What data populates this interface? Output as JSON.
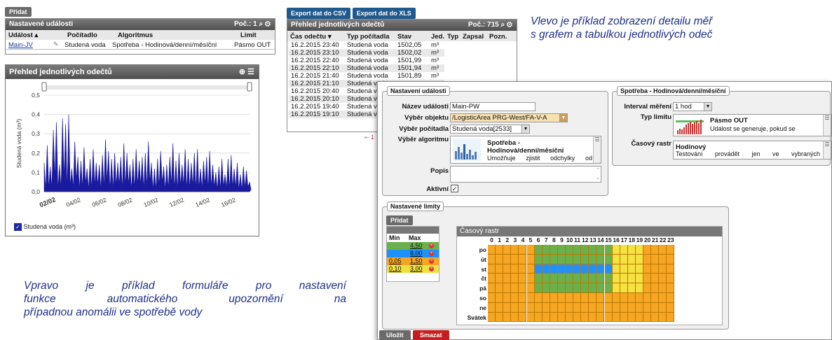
{
  "left_panel": {
    "add_button": "Přidat",
    "title": "Nastavené události",
    "count_label": "Poč.: 1",
    "columns": [
      "Událost",
      "Počítadlo",
      "Algoritmus",
      "Limit"
    ],
    "row": {
      "event": "Main-JV",
      "counter": "Studená voda",
      "algorithm": "Spotřeba - Hodinová/denní/měsíční",
      "limit": "Pásmo OUT"
    }
  },
  "chart_panel": {
    "title": "Přehled jednotlivých odečtů",
    "legend_label": "Studená voda (m³)"
  },
  "chart_data": {
    "type": "area",
    "ylabel": "Studená voda (m³)",
    "yticks": [
      "0,5",
      "0,4",
      "0,3",
      "0,2",
      "0,1",
      "0,0"
    ],
    "ylim": [
      0,
      0.5
    ],
    "xticks": [
      "02/02",
      "04/02",
      "06/02",
      "08/02",
      "10/02",
      "12/02",
      "14/02",
      "16/02"
    ],
    "series": [
      {
        "name": "Studená voda (m³)",
        "values": [
          0.15,
          0.24,
          0.13,
          0.32,
          0.36,
          0.14,
          0.38,
          0.35,
          0.4,
          0.12,
          0.26,
          0.18,
          0.16,
          0.23,
          0.12,
          0.17,
          0.22,
          0.15,
          0.14,
          0.19,
          0.27,
          0.21,
          0.17,
          0.2,
          0.15,
          0.18,
          0.25,
          0.2,
          0.14,
          0.17,
          0.22,
          0.16,
          0.18,
          0.2,
          0.26,
          0.15,
          0.12,
          0.17,
          0.21,
          0.13,
          0.14,
          0.18,
          0.25,
          0.16,
          0.2,
          0.14,
          0.22,
          0.17,
          0.15,
          0.2,
          0.22,
          0.12,
          0.16,
          0.18,
          0.21,
          0.14,
          0.1,
          0.13,
          0.17,
          0.09,
          0.17,
          0.19,
          0.12,
          0.15,
          0.09,
          0.13,
          0.11,
          0.05
        ]
      }
    ],
    "color": "#1a1a9e"
  },
  "readings_panel": {
    "export_csv": "Export dat do CSV",
    "export_xls": "Export dat do XLS",
    "title": "Přehled jednotlivých odečtů",
    "count_label": "Poč.: 715",
    "columns": [
      "Čas odečtu",
      "Typ počítadla",
      "Stav",
      "Jed.",
      "Typ",
      "Zapsal",
      "Pozn."
    ],
    "rows": [
      [
        "16.2.2015 23:40",
        "Studená voda",
        "1502,05",
        "m³"
      ],
      [
        "16.2.2015 23:10",
        "Studená voda",
        "1502,02",
        "m³"
      ],
      [
        "16.2.2015 22:40",
        "Studená voda",
        "1501,99",
        "m³"
      ],
      [
        "16.2.2015 22:10",
        "Studená voda",
        "1501,94",
        "m³"
      ],
      [
        "16.2.2015 21:40",
        "Studená voda",
        "1501,89",
        "m³"
      ],
      [
        "16.2.2015 21:10",
        "Studená voda",
        "",
        ""
      ],
      [
        "16.2.2015 20:40",
        "Studená voda",
        "",
        ""
      ],
      [
        "16.2.2015 20:10",
        "Studená voda",
        "",
        ""
      ],
      [
        "16.2.2015 19:40",
        "Studená voda",
        "",
        ""
      ],
      [
        "16.2.2015 19:10",
        "Studená voda",
        "",
        ""
      ]
    ],
    "pager": "1"
  },
  "note_top": [
    "Vlevo je příklad zobrazení detailu měř",
    "s grafem a tabulkou jednotlivých odeč"
  ],
  "note_bottom": [
    "Vpravo je příklad formuláře pro nastavení",
    "funkce automatického upozornění na",
    "případnou anomálii ve spotřebě vody"
  ],
  "event_settings": {
    "legend": "Nastavení události",
    "name_label": "Název události",
    "name_value": "Main-PW",
    "object_label": "Výběr objektu",
    "object_value": "/LogisticArea PRG-West/FA-V-A",
    "counter_label": "Výběr počítadla",
    "counter_value": "Studená voda[2533]",
    "algorithm_label": "Výběr algoritmu",
    "algorithm_title": "Spotřeba - Hodinová/denní/měsíční",
    "algorithm_desc": "Umožňuje zjistit odchylky od",
    "description_label": "Popis",
    "active_label": "Aktivní",
    "active_check": "✓"
  },
  "consumption_settings": {
    "legend": "Spotřeba - Hodinová/denní/měsíční",
    "interval_label": "Interval měření",
    "interval_value": "1 hod",
    "limit_type_label": "Typ limitu",
    "limit_type_title": "Pásmo OUT",
    "limit_type_desc": "Událost se generuje, pokud se",
    "raster_label": "Časový rastr",
    "raster_title": "Hodinový",
    "raster_desc": "Testování provádět jen ve vybraných"
  },
  "limits": {
    "legend": "Nastavené limity",
    "add_button": "Přidat",
    "min_label": "Min",
    "max_label": "Max",
    "rows": [
      {
        "min": "",
        "max": "4,50",
        "color": "#6ab04c"
      },
      {
        "min": "",
        "max": "8,00",
        "color": "#1e90ff"
      },
      {
        "min": "0,05",
        "max": "1,50",
        "color": "#f5a623"
      },
      {
        "min": "0,10",
        "max": "3,00",
        "color": "#f0e040"
      }
    ],
    "raster_title": "Časový rastr",
    "hours": [
      "0",
      "1",
      "2",
      "3",
      "4",
      "5",
      "6",
      "7",
      "8",
      "9",
      "10",
      "11",
      "12",
      "13",
      "14",
      "15",
      "16",
      "17",
      "18",
      "19",
      "20",
      "21",
      "22",
      "23"
    ],
    "days": [
      "po",
      "út",
      "st",
      "čt",
      "pá",
      "so",
      "ne",
      "Svátek"
    ]
  },
  "footer": {
    "save": "Uložit",
    "delete": "Smazat"
  }
}
